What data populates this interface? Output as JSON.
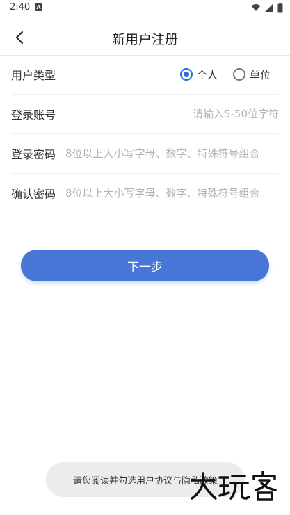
{
  "status_bar": {
    "time": "2:40",
    "notification_badge": "A"
  },
  "header": {
    "title": "新用户注册"
  },
  "form": {
    "user_type": {
      "label": "用户类型",
      "options": [
        {
          "label": "个人",
          "checked": true
        },
        {
          "label": "单位",
          "checked": false
        }
      ]
    },
    "account": {
      "label": "登录账号",
      "value": "",
      "placeholder": "请输入5-50位字符"
    },
    "password": {
      "label": "登录密码",
      "value": "",
      "placeholder": "8位以上大小写字母、数字、特殊符号组合"
    },
    "confirm_password": {
      "label": "确认密码",
      "value": "",
      "placeholder": "8位以上大小写字母、数字、特殊符号组合"
    }
  },
  "next_button": {
    "label": "下一步"
  },
  "toast": {
    "message": "请您阅读并勾选用户协议与隐私政策"
  },
  "watermark": {
    "text": "大玩客"
  },
  "colors": {
    "accent": "#4876d6",
    "radio_checked": "#1f6fe0",
    "placeholder": "#b3b3b3"
  }
}
